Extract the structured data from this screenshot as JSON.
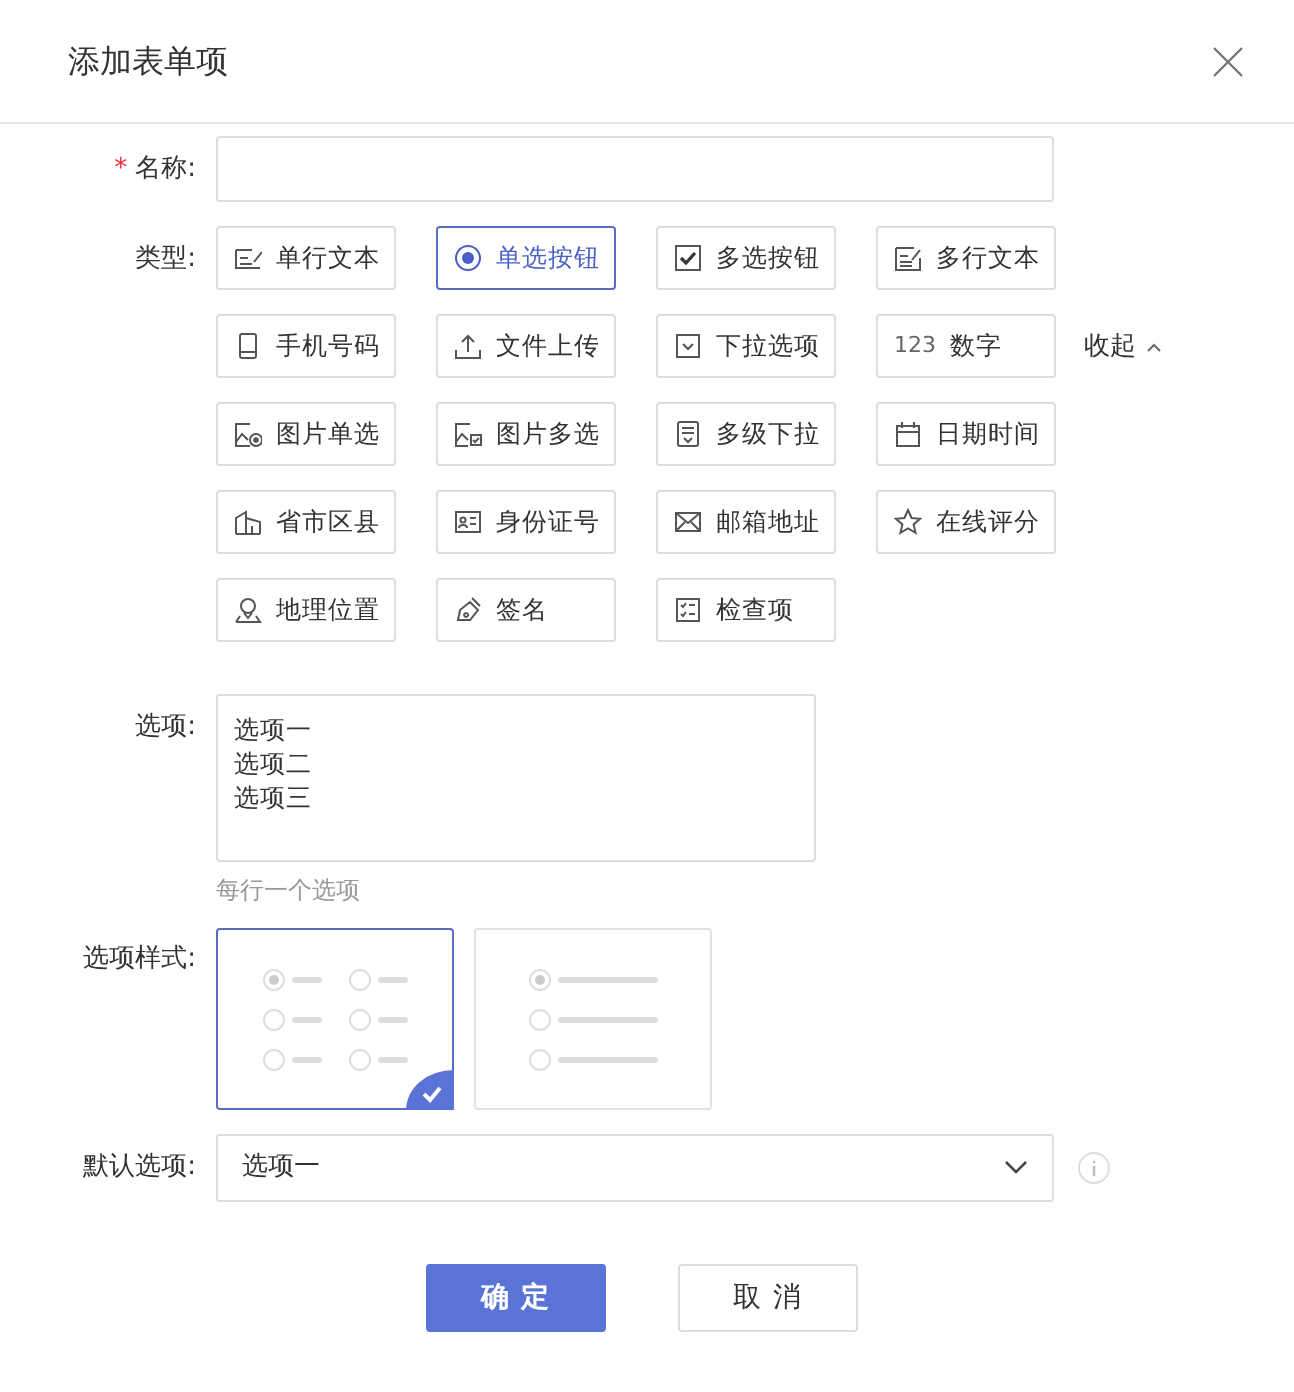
{
  "dialog": {
    "title": "添加表单项"
  },
  "name_field": {
    "required_mark": "*",
    "label": "名称:"
  },
  "type_field": {
    "label": "类型:",
    "collapse": "收起",
    "items": [
      {
        "label": "单行文本",
        "kind": "single-text",
        "selected": false
      },
      {
        "label": "单选按钮",
        "kind": "radio",
        "selected": true
      },
      {
        "label": "多选按钮",
        "kind": "checkbox",
        "selected": false
      },
      {
        "label": "多行文本",
        "kind": "multi-text",
        "selected": false
      },
      {
        "label": "手机号码",
        "kind": "phone",
        "selected": false
      },
      {
        "label": "文件上传",
        "kind": "upload",
        "selected": false
      },
      {
        "label": "下拉选项",
        "kind": "dropdown",
        "selected": false
      },
      {
        "label": "数字",
        "kind": "number",
        "icon_text": "123",
        "selected": false
      },
      {
        "label": "图片单选",
        "kind": "image-radio",
        "selected": false
      },
      {
        "label": "图片多选",
        "kind": "image-check",
        "selected": false
      },
      {
        "label": "多级下拉",
        "kind": "cascade",
        "selected": false
      },
      {
        "label": "日期时间",
        "kind": "date",
        "selected": false
      },
      {
        "label": "省市区县",
        "kind": "region",
        "selected": false
      },
      {
        "label": "身份证号",
        "kind": "idcard",
        "selected": false
      },
      {
        "label": "邮箱地址",
        "kind": "email",
        "selected": false
      },
      {
        "label": "在线评分",
        "kind": "rating",
        "selected": false
      },
      {
        "label": "地理位置",
        "kind": "location",
        "selected": false
      },
      {
        "label": "签名",
        "kind": "signature",
        "selected": false
      },
      {
        "label": "检查项",
        "kind": "checklist",
        "selected": false
      }
    ]
  },
  "options_field": {
    "label": "选项:",
    "lines": [
      "选项一",
      "选项二",
      "选项三"
    ],
    "hint": "每行一个选项"
  },
  "style_field": {
    "label": "选项样式:",
    "options": [
      {
        "kind": "grid",
        "selected": true
      },
      {
        "kind": "list",
        "selected": false
      }
    ]
  },
  "default_field": {
    "label": "默认选项:",
    "value": "选项一"
  },
  "buttons": [
    {
      "label": "确定",
      "kind": "primary"
    },
    {
      "label": "取消",
      "kind": "secondary"
    }
  ]
}
